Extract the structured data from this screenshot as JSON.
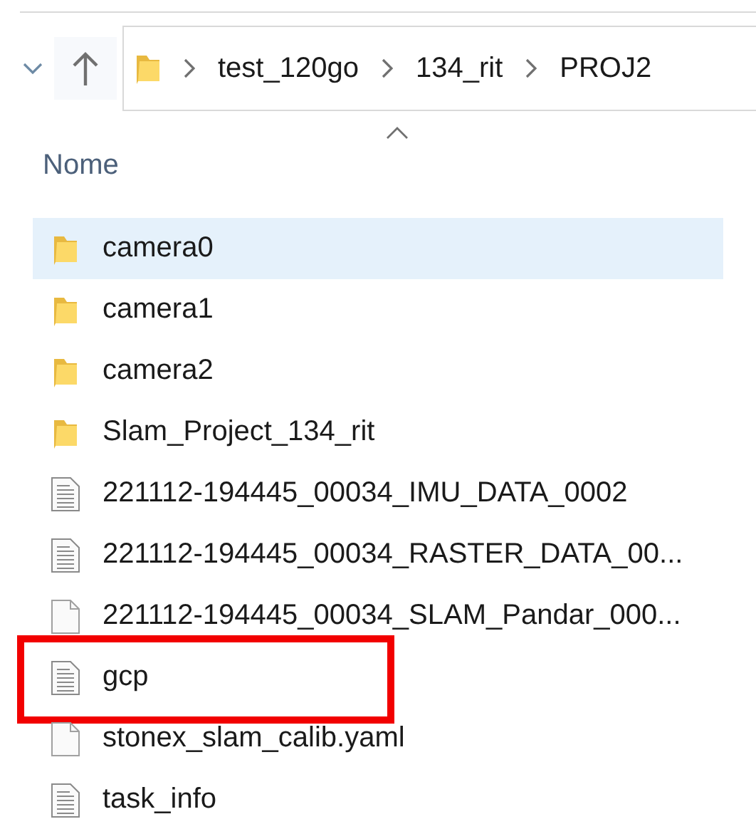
{
  "address_bar": {
    "path": [
      "test_120go",
      "134_rit",
      "PROJ2"
    ]
  },
  "column_header": {
    "label": "Nome",
    "sorted": true
  },
  "files": [
    {
      "name": "camera0",
      "kind": "folder",
      "selected": true,
      "highlighted": false
    },
    {
      "name": "camera1",
      "kind": "folder",
      "selected": false,
      "highlighted": false
    },
    {
      "name": "camera2",
      "kind": "folder",
      "selected": false,
      "highlighted": false
    },
    {
      "name": "Slam_Project_134_rit",
      "kind": "folder",
      "selected": false,
      "highlighted": false
    },
    {
      "name": "221112-194445_00034_IMU_DATA_0002",
      "kind": "text",
      "selected": false,
      "highlighted": false
    },
    {
      "name": "221112-194445_00034_RASTER_DATA_00...",
      "kind": "text",
      "selected": false,
      "highlighted": false
    },
    {
      "name": "221112-194445_00034_SLAM_Pandar_000...",
      "kind": "blank",
      "selected": false,
      "highlighted": false
    },
    {
      "name": "gcp",
      "kind": "text",
      "selected": false,
      "highlighted": true
    },
    {
      "name": "stonex_slam_calib.yaml",
      "kind": "blank",
      "selected": false,
      "highlighted": false
    },
    {
      "name": "task_info",
      "kind": "text",
      "selected": false,
      "highlighted": false
    }
  ]
}
